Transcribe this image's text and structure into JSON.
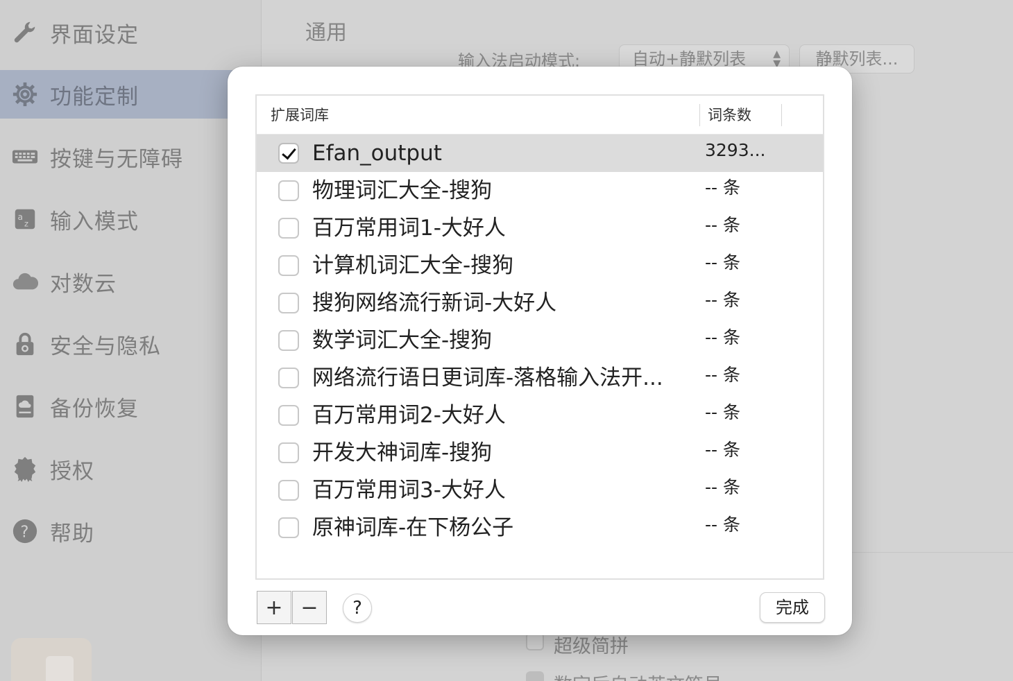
{
  "sidebar": {
    "items": [
      {
        "label": "界面设定",
        "icon": "wrench-icon"
      },
      {
        "label": "功能定制",
        "icon": "gear-icon",
        "selected": true
      },
      {
        "label": "按键与无障碍",
        "icon": "keyboard-icon"
      },
      {
        "label": "输入模式",
        "icon": "input-mode-icon"
      },
      {
        "label": "对数云",
        "icon": "cloud-icon"
      },
      {
        "label": "安全与隐私",
        "icon": "lock-icon"
      },
      {
        "label": "备份恢复",
        "icon": "backup-drive-icon"
      },
      {
        "label": "授权",
        "icon": "badge-icon"
      },
      {
        "label": "帮助",
        "icon": "help-icon"
      }
    ]
  },
  "main": {
    "title": "通用",
    "mode_label": "输入法启动模式:",
    "mode_value": "自动+静默列表",
    "silent_list_button": "静默列表...",
    "bg_checkboxes": [
      {
        "label": "超级简拼",
        "checked": false
      },
      {
        "label": "数字后自动英文符号",
        "checked": true
      }
    ]
  },
  "dialog": {
    "columns": {
      "name": "扩展词库",
      "count": "词条数"
    },
    "rows": [
      {
        "name": "Efan_output",
        "count": "3293...",
        "checked": true,
        "selected": true
      },
      {
        "name": "物理词汇大全-搜狗",
        "count": "-- 条",
        "checked": false
      },
      {
        "name": "百万常用词1-大好人",
        "count": "-- 条",
        "checked": false
      },
      {
        "name": "计算机词汇大全-搜狗",
        "count": "-- 条",
        "checked": false
      },
      {
        "name": "搜狗网络流行新词-大好人",
        "count": "-- 条",
        "checked": false
      },
      {
        "name": "数学词汇大全-搜狗",
        "count": "-- 条",
        "checked": false
      },
      {
        "name": "网络流行语日更词库-落格输入法开...",
        "count": "-- 条",
        "checked": false
      },
      {
        "name": "百万常用词2-大好人",
        "count": "-- 条",
        "checked": false
      },
      {
        "name": "开发大神词库-搜狗",
        "count": "-- 条",
        "checked": false
      },
      {
        "name": "百万常用词3-大好人",
        "count": "-- 条",
        "checked": false
      },
      {
        "name": "原神词库-在下杨公子",
        "count": "-- 条",
        "checked": false
      }
    ],
    "add_label": "+",
    "remove_label": "−",
    "help_label": "?",
    "done_label": "完成"
  }
}
